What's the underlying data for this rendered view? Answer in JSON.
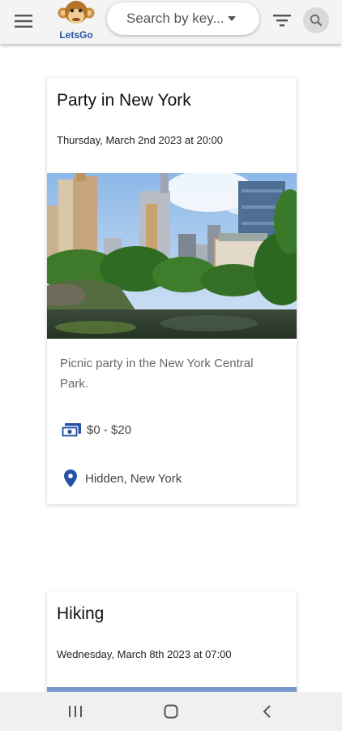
{
  "app": {
    "logo_text": "LetsGo",
    "search_placeholder": "Search by key..."
  },
  "colors": {
    "brand_blue": "#2453a6",
    "appbar_bg": "#f4f4f4"
  },
  "icons": {
    "menu": "hamburger-menu-icon",
    "filter": "filter-icon",
    "search": "search-icon",
    "price": "money-icon",
    "location": "location-pin-icon",
    "nav_recents": "recents-icon",
    "nav_home": "home-icon",
    "nav_back": "back-icon"
  },
  "events": [
    {
      "title": "Party in New York",
      "date": "Thursday, March 2nd 2023 at 20:00",
      "image_alt": "",
      "description": "Picnic party in the New York Central Park.",
      "price": "$0 - $20",
      "location": "Hidden, New York"
    },
    {
      "title": "Hiking",
      "date": "Wednesday, March 8th 2023 at 07:00"
    }
  ]
}
